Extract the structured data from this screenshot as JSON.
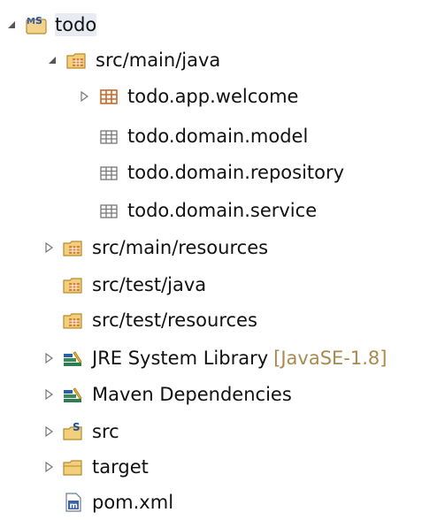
{
  "tree": {
    "root": {
      "label": "todo",
      "icon": "maven-project-icon",
      "expanded": true
    },
    "main_java": {
      "label": "src/main/java",
      "icon": "source-folder-icon",
      "expanded": true,
      "packages": [
        {
          "label": "todo.app.welcome",
          "icon": "package-icon",
          "expandable": true
        },
        {
          "label": "todo.domain.model",
          "icon": "empty-package-icon",
          "expandable": false
        },
        {
          "label": "todo.domain.repository",
          "icon": "empty-package-icon",
          "expandable": false
        },
        {
          "label": "todo.domain.service",
          "icon": "empty-package-icon",
          "expandable": false
        }
      ]
    },
    "items": [
      {
        "label": "src/main/resources",
        "icon": "source-folder-icon",
        "expandable": true
      },
      {
        "label": "src/test/java",
        "icon": "source-folder-icon",
        "expandable": false
      },
      {
        "label": "src/test/resources",
        "icon": "source-folder-icon",
        "expandable": false
      },
      {
        "label": "JRE System Library",
        "decoration": "[JavaSE-1.8]",
        "icon": "library-icon",
        "expandable": true
      },
      {
        "label": "Maven Dependencies",
        "icon": "library-icon",
        "expandable": true
      },
      {
        "label": "src",
        "icon": "spring-folder-icon",
        "expandable": true
      },
      {
        "label": "target",
        "icon": "folder-icon",
        "expandable": true
      },
      {
        "label": "pom.xml",
        "icon": "maven-pom-icon",
        "expandable": false
      }
    ]
  },
  "colors": {
    "folder": "#f2cf7a",
    "folder_stroke": "#b88a2e",
    "package": "#c9672a",
    "library": "#2e7d4f",
    "decoration": "#a88a4e"
  }
}
